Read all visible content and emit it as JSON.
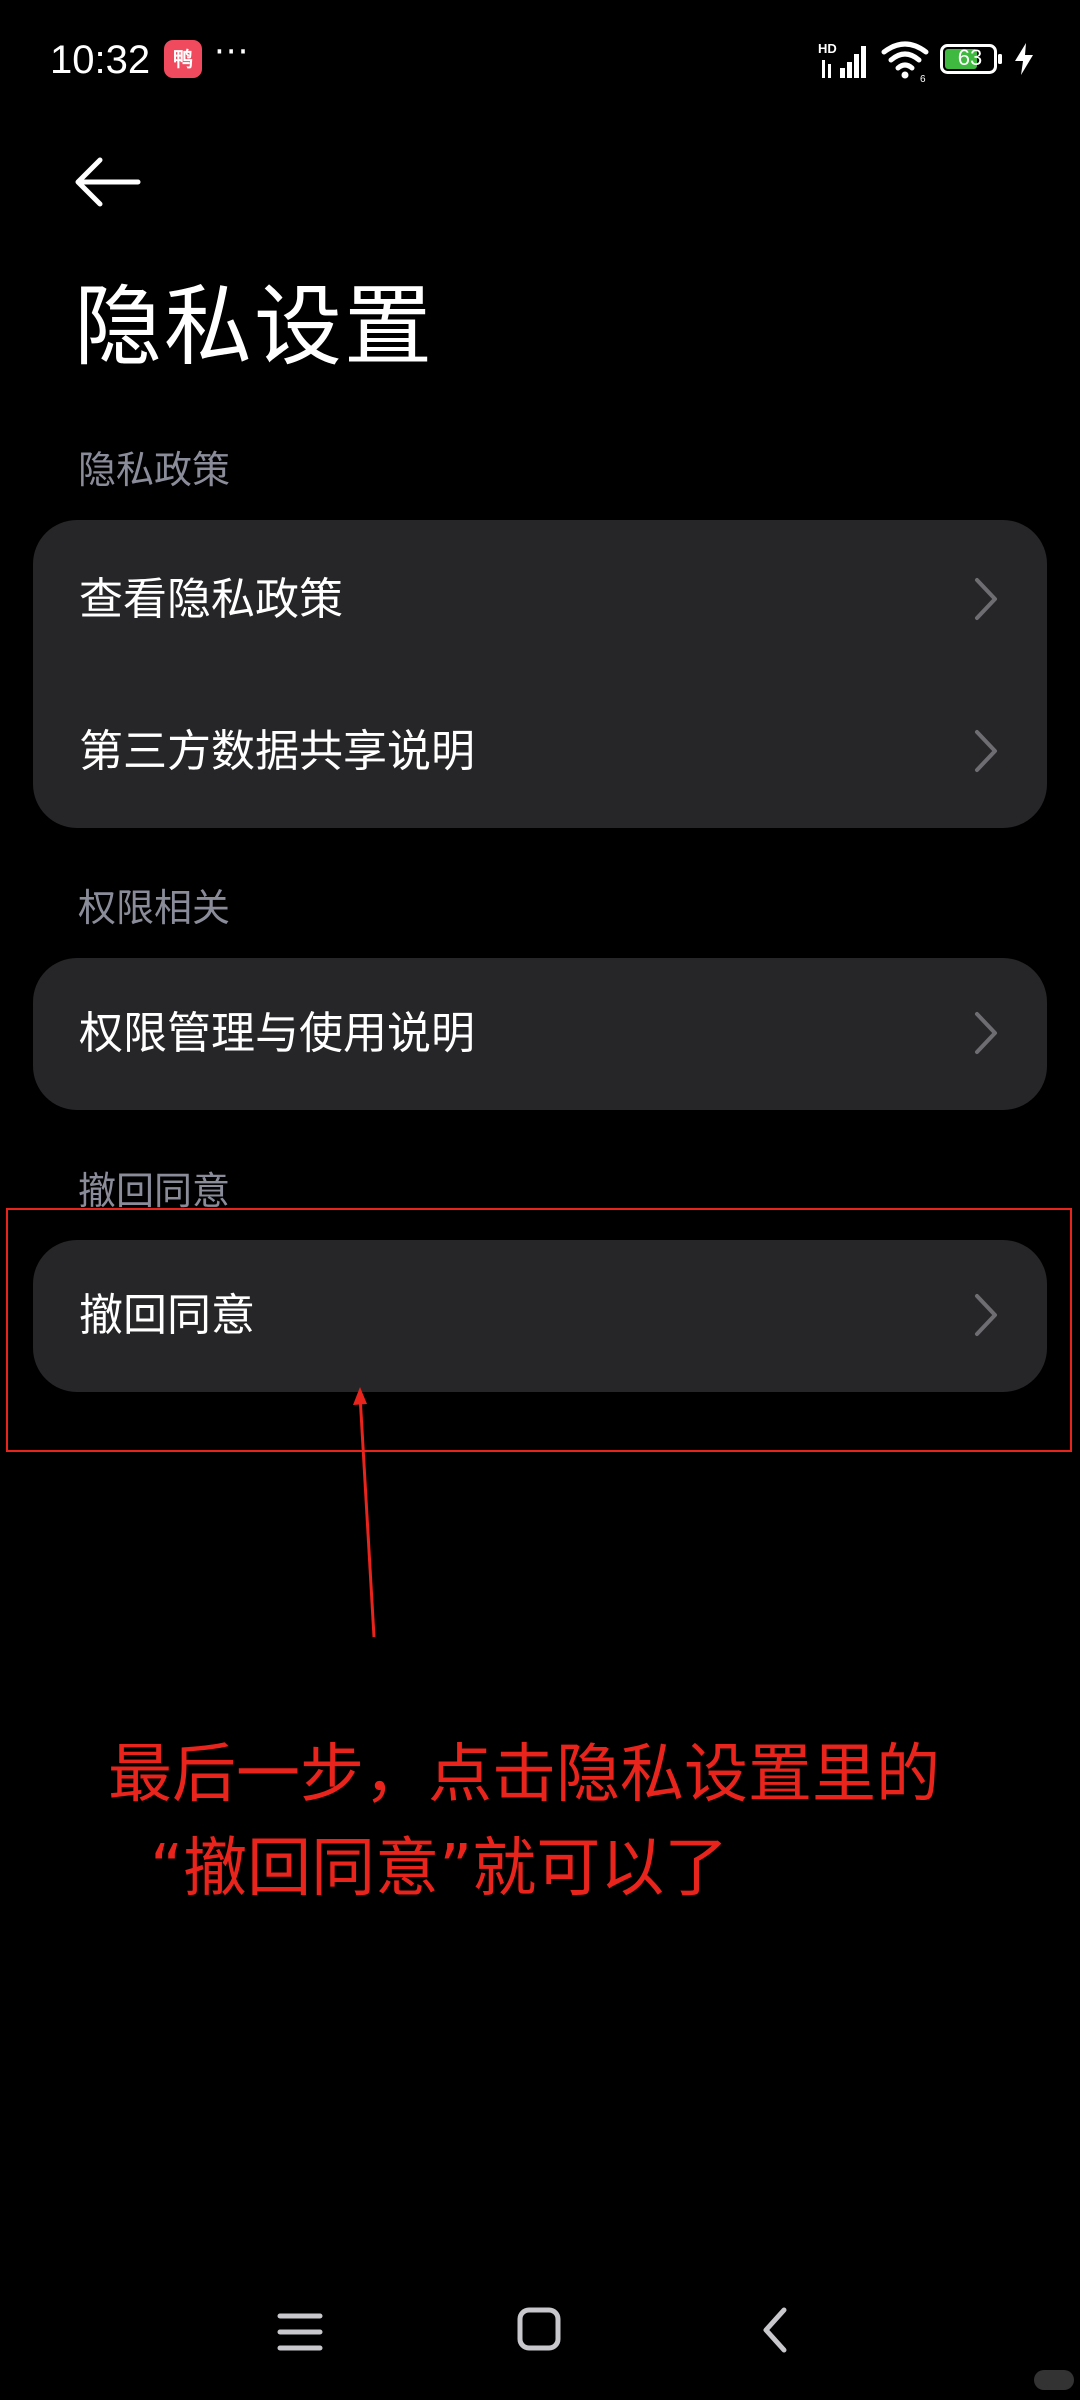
{
  "status_bar": {
    "time": "10:32",
    "app_icon": "app-notification-icon",
    "more": "···",
    "signal_label": "HD",
    "battery_level": "63",
    "icons": [
      "signal-icon",
      "wifi-icon",
      "battery-icon",
      "charging-icon"
    ]
  },
  "header": {
    "back_icon": "back-arrow-icon",
    "title": "隐私设置"
  },
  "sections": [
    {
      "title": "隐私政策",
      "items": [
        {
          "label": "查看隐私政策"
        },
        {
          "label": "第三方数据共享说明"
        }
      ]
    },
    {
      "title": "权限相关",
      "items": [
        {
          "label": "权限管理与使用说明"
        }
      ]
    },
    {
      "title": "撤回同意",
      "items": [
        {
          "label": "撤回同意"
        }
      ]
    }
  ],
  "annotation": {
    "line1": "最后一步，点击隐私设置里的",
    "line2": "“撤回同意”就可以了",
    "color": "#e8241c"
  },
  "nav_bar": {
    "icons": [
      "menu-icon",
      "home-icon",
      "back-icon"
    ]
  },
  "colors": {
    "background": "#000000",
    "card": "#262628",
    "section_header": "#8a8c9a",
    "chevron": "#6e6e72"
  }
}
